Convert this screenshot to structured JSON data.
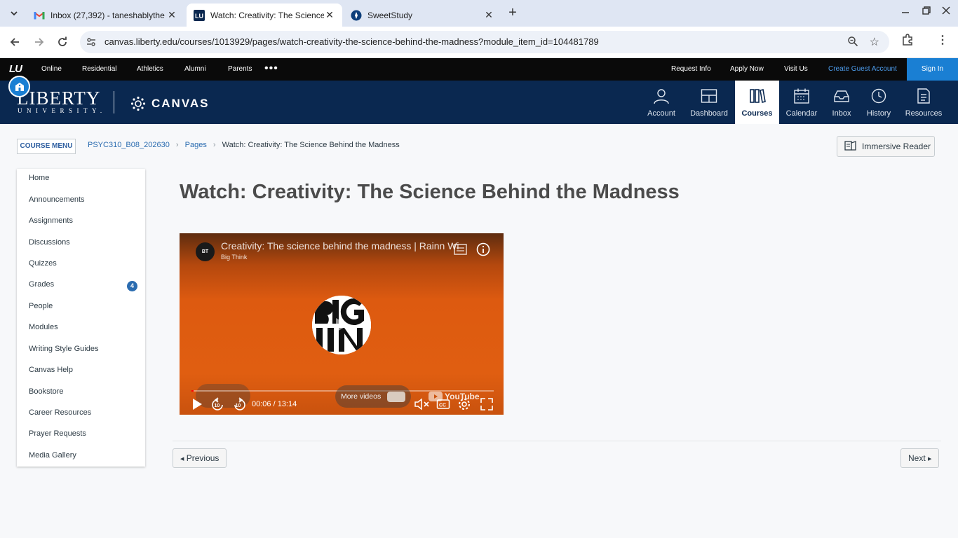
{
  "browser": {
    "tabs": [
      {
        "title": "Inbox (27,392) - taneshablythe",
        "favicon": "gmail-icon"
      },
      {
        "title": "Watch: Creativity: The Science B",
        "favicon": "liberty-icon",
        "active": true
      },
      {
        "title": "SweetStudy",
        "favicon": "sweetstudy-icon"
      }
    ],
    "url": "canvas.liberty.edu/courses/1013929/pages/watch-creativity-the-science-behind-the-madness?module_item_id=104481789"
  },
  "lu_topbar": {
    "logo": "LU",
    "left_links": [
      "Online",
      "Residential",
      "Athletics",
      "Alumni",
      "Parents"
    ],
    "more": "•••",
    "right_links": [
      "Request Info",
      "Apply Now",
      "Visit Us"
    ],
    "guest": "Create Guest Account",
    "sign_in": "Sign In"
  },
  "header": {
    "brand": "LIBERTY",
    "brand_sub": "UNIVERSITY.",
    "canvas": "CANVAS",
    "global_nav": [
      {
        "label": "Account",
        "icon": "account-icon"
      },
      {
        "label": "Dashboard",
        "icon": "dashboard-icon"
      },
      {
        "label": "Courses",
        "icon": "courses-icon",
        "active": true
      },
      {
        "label": "Calendar",
        "icon": "calendar-icon"
      },
      {
        "label": "Inbox",
        "icon": "inbox-icon"
      },
      {
        "label": "History",
        "icon": "history-icon"
      },
      {
        "label": "Resources",
        "icon": "resources-icon"
      }
    ]
  },
  "page": {
    "course_menu": "COURSE MENU",
    "breadcrumbs": [
      "PSYC310_B08_202630",
      "Pages",
      "Watch: Creativity: The Science Behind the Madness"
    ],
    "immersive_reader": "Immersive Reader",
    "title": "Watch: Creativity: The Science Behind the Madness",
    "course_nav": [
      "Home",
      "Announcements",
      "Assignments",
      "Discussions",
      "Quizzes",
      "Grades",
      "People",
      "Modules",
      "Writing Style Guides",
      "Canvas Help",
      "Bookstore",
      "Career Resources",
      "Prayer Requests",
      "Media Gallery"
    ],
    "grades_badge": "4",
    "previous": "Previous",
    "next": "Next"
  },
  "video": {
    "title": "Creativity: The science behind the madness | Rainn Wi",
    "channel": "Big Think",
    "channel_logo": "BT",
    "time": "00:06 / 13:14",
    "progress": 0.008,
    "more_videos": "More videos",
    "youtube": "YouTube",
    "skip_seconds": "10"
  },
  "colors": {
    "header": "#0a2850",
    "accent": "#1a7fd3",
    "link": "#2b6cb0"
  }
}
